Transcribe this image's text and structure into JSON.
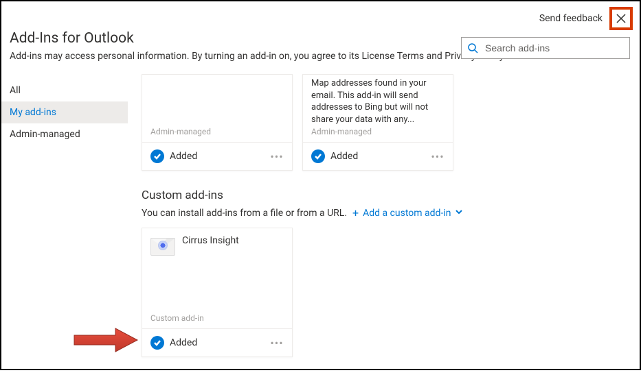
{
  "header": {
    "feedback": "Send feedback"
  },
  "title": "Add-Ins for Outlook",
  "subtitle": "Add-ins may access personal information. By turning an add-in on, you agree to its License Terms and Privacy Policy.",
  "search": {
    "placeholder": "Search add-ins"
  },
  "sidebar": {
    "items": [
      {
        "label": "All"
      },
      {
        "label": "My add-ins"
      },
      {
        "label": "Admin-managed"
      }
    ],
    "active_index": 1
  },
  "cards_row1": [
    {
      "desc": "",
      "subtype": "Admin-managed",
      "status": "Added"
    },
    {
      "desc": "Map addresses found in your email. This add-in will send addresses to Bing but will not share your data with any...",
      "subtype": "Admin-managed",
      "status": "Added"
    }
  ],
  "custom_section": {
    "title": "Custom add-ins",
    "subtitle": "You can install add-ins from a file or from a URL.",
    "add_label": "Add a custom add-in"
  },
  "custom_cards": [
    {
      "name": "Cirrus Insight",
      "subtype": "Custom add-in",
      "status": "Added"
    }
  ],
  "ellipsis": "•••"
}
